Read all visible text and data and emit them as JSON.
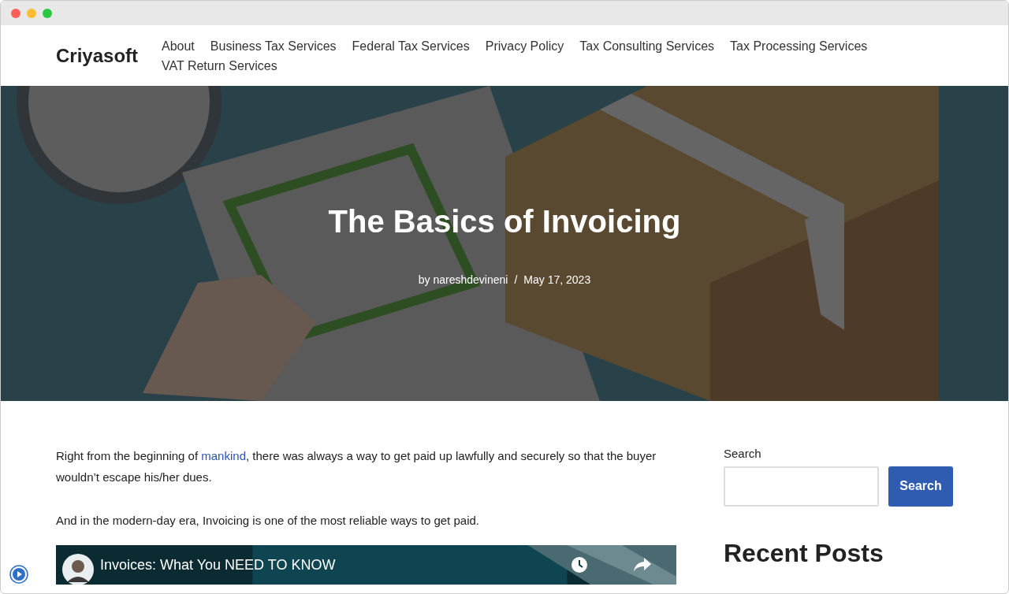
{
  "window": {
    "controls": [
      {
        "color": "#ff5f57"
      },
      {
        "color": "#febc2e"
      },
      {
        "color": "#28c840"
      }
    ]
  },
  "site": {
    "logo": "Criyasoft"
  },
  "nav": {
    "items": [
      "About",
      "Business Tax Services",
      "Federal Tax Services",
      "Privacy Policy",
      "Tax Consulting Services",
      "Tax Processing Services",
      "VAT Return Services"
    ]
  },
  "hero": {
    "kind": "picture",
    "title": "The Basics of Invoicing",
    "author": "by nareshdevineni",
    "separator": "/",
    "date": "May 17, 2023"
  },
  "article": {
    "paragraphs": [
      {
        "before": "Right from the beginning of ",
        "link": "mankind",
        "after": ", there was always a way to get paid up lawfully and securely so that the buyer wouldn’t escape his/her dues."
      },
      {
        "before": "And in the modern-day era, Invoicing is one of the most reliable ways to get paid."
      }
    ],
    "video": {
      "title": "Invoices: What You NEED TO KNOW"
    }
  },
  "sidebar": {
    "search_label": "Search",
    "search_button": "Search",
    "recent_title": "Recent Posts"
  }
}
